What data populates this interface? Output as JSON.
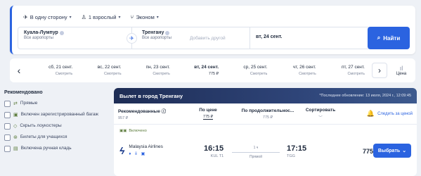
{
  "search": {
    "trip_type": "В одну сторону",
    "passengers": "1 взрослый",
    "cabin": "Эконом",
    "from_city": "Куала-Лумпур",
    "from_sub": "Все аэропорты",
    "to_city": "Тренгану",
    "to_sub": "Все аэропорты",
    "add_other": "Добавить другой",
    "date": "вт, 24 сент.",
    "find_label": "Найти"
  },
  "date_strip": {
    "dates": [
      {
        "day": "сб, 21 сент.",
        "price": "Смотреть"
      },
      {
        "day": "вс, 22 сент.",
        "price": "Смотреть"
      },
      {
        "day": "пн, 23 сент.",
        "price": "Смотреть"
      },
      {
        "day": "вт, 24 сент.",
        "price": "775 ₽"
      },
      {
        "day": "ср, 25 сент.",
        "price": "Смотреть"
      },
      {
        "day": "чт, 26 сент.",
        "price": "Смотреть"
      },
      {
        "day": "пт, 27 сент.",
        "price": "Смотреть"
      }
    ],
    "price_label": "Цена"
  },
  "filters": {
    "title": "Рекомендовано",
    "items": [
      "Прямые",
      "Включен зарегистрированный багаж",
      "Скрыть лоукостеры",
      "Билеты для учащихся",
      "Включена ручная кладь"
    ]
  },
  "results": {
    "banner_title": "Вылет в город Тренгану",
    "last_update": "*Последнее обновление: 13 июля, 2024 г., 12:09:45",
    "sort": {
      "recommended": "Рекомендованные",
      "recommended_price": "957 ₽",
      "cheapest": "По цене",
      "cheapest_price": "775 ₽",
      "duration": "По продолжительнос...",
      "duration_price": "775 ₽",
      "sort_label": "Сортировать"
    },
    "follow_price": "Следить за ценой",
    "flight": {
      "included": "Включено",
      "airline": "Malaysia Airlines",
      "dep_time": "16:15",
      "dep_airport": "KUL T1",
      "duration": "1 ч",
      "stops": "Прямой",
      "arr_time": "17:15",
      "arr_airport": "TGG",
      "price": "775 ₽",
      "choose": "Выбрать"
    }
  }
}
